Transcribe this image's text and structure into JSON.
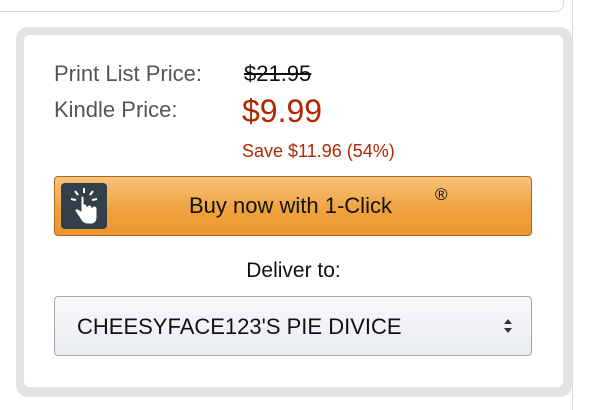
{
  "pricing": {
    "print_list_label": "Print List Price:",
    "print_list_value": "$21.95",
    "kindle_label": "Kindle Price:",
    "kindle_value": "$9.99",
    "savings": "Save $11.96 (54%)"
  },
  "buy_button": {
    "label": "Buy now with 1-Click",
    "registered_mark": "®",
    "icon": "one-click-hand-icon"
  },
  "delivery": {
    "label": "Deliver to:",
    "selected_device": "CHEESYFACE123'S PIE DIVICE",
    "arrows_icon": "select-updown-icon"
  },
  "colors": {
    "price_red": "#b12704",
    "button_orange": "#f0a33f",
    "icon_bg": "#333f49"
  }
}
